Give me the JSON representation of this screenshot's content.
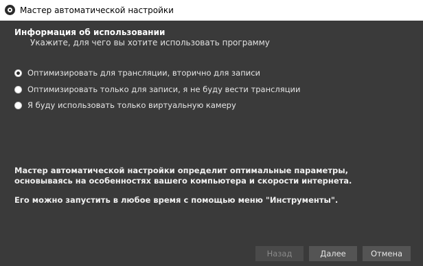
{
  "window": {
    "title": "Мастер автоматической настройки"
  },
  "section": {
    "title": "Информация об использовании",
    "subtitle": "Укажите, для чего вы хотите использовать программу"
  },
  "options": [
    {
      "label": "Оптимизировать для трансляции, вторично для записи",
      "checked": true
    },
    {
      "label": "Оптимизировать только для записи, я не буду вести трансляции",
      "checked": false
    },
    {
      "label": "Я буду использовать только виртуальную камеру",
      "checked": false
    }
  ],
  "info": {
    "line1": "Мастер автоматической настройки определит оптимальные параметры, основываясь на особенностях вашего компьютера и скорости интернета.",
    "line2": "Его можно запустить в любое время с помощью меню \"Инструменты\"."
  },
  "buttons": {
    "back": "Назад",
    "next": "Далее",
    "cancel": "Отмена"
  },
  "colors": {
    "background": "#3a3a3a",
    "button": "#545454",
    "titlebar": "#ffffff"
  }
}
